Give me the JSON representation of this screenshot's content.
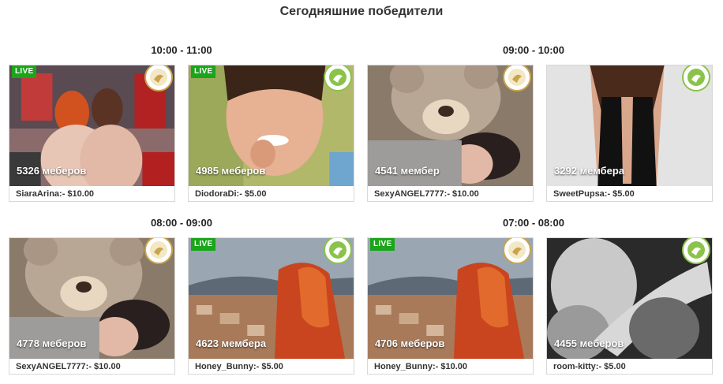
{
  "page": {
    "title": "Сегодняшние победители"
  },
  "colors": {
    "live_badge": "#1aa51a",
    "logo_gold": "#c9a44a",
    "logo_green": "#8bc34a"
  },
  "slots": [
    "10:00 - 11:00",
    "09:00 - 10:00",
    "08:00 - 09:00",
    "07:00 - 08:00"
  ],
  "live_label": "LIVE",
  "cards": [
    {
      "members": "5326 меберов",
      "caption": "SiaraArina:- $10.00",
      "live": true,
      "logo": "gold-logo-icon"
    },
    {
      "members": "4985 меберов",
      "caption": "DiodoraDi:- $5.00",
      "live": true,
      "logo": "green-logo-icon"
    },
    {
      "members": "4541 мембер",
      "caption": "SexyANGEL7777:- $10.00",
      "live": false,
      "logo": "gold-logo-icon"
    },
    {
      "members": "3292 мембера",
      "caption": "SweetPupsa:- $5.00",
      "live": false,
      "logo": "green-logo-icon"
    },
    {
      "members": "4778 меберов",
      "caption": "SexyANGEL7777:- $10.00",
      "live": false,
      "logo": "gold-logo-icon"
    },
    {
      "members": "4623 мембера",
      "caption": "Honey_Bunny:- $5.00",
      "live": true,
      "logo": "green-logo-icon"
    },
    {
      "members": "4706 меберов",
      "caption": "Honey_Bunny:- $10.00",
      "live": true,
      "logo": "gold-logo-icon"
    },
    {
      "members": "4455 меберов",
      "caption": "room-kitty:- $5.00",
      "live": false,
      "logo": "green-logo-icon"
    }
  ]
}
